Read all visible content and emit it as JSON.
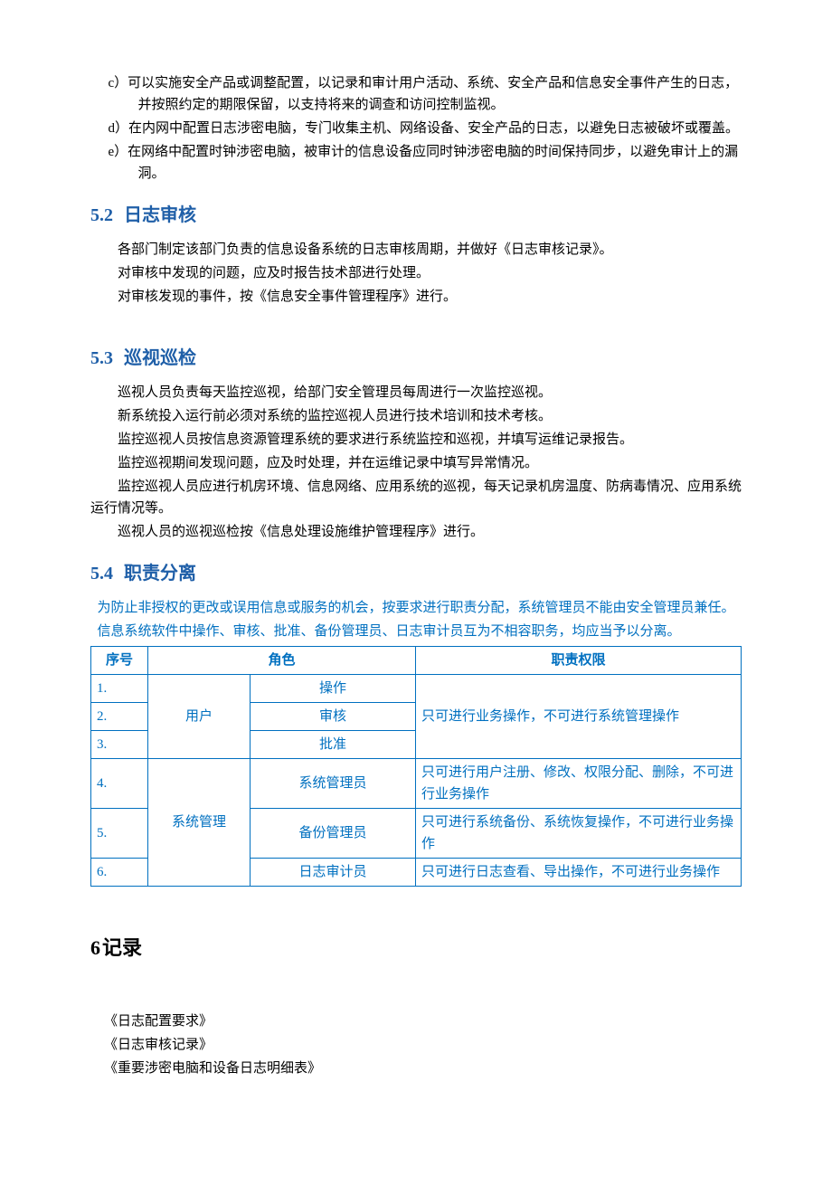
{
  "intro_items": [
    "c）可以实施安全产品或调整配置，以记录和审计用户活动、系统、安全产品和信息安全事件产生的日志，并按照约定的期限保留，以支持将来的调查和访问控制监视。",
    "d）在内网中配置日志涉密电脑，专门收集主机、网络设备、安全产品的日志，以避免日志被破坏或覆盖。",
    "e）在网络中配置时钟涉密电脑，被审计的信息设备应同时钟涉密电脑的时间保持同步，以避免审计上的漏洞。"
  ],
  "s52": {
    "num": "5.2",
    "title": "日志审核",
    "paras": [
      "各部门制定该部门负责的信息设备系统的日志审核周期，并做好《日志审核记录》。",
      "对审核中发现的问题，应及时报告技术部进行处理。",
      "对审核发现的事件，按《信息安全事件管理程序》进行。"
    ]
  },
  "s53": {
    "num": "5.3",
    "title": "巡视巡检",
    "paras": [
      "巡视人员负责每天监控巡视，给部门安全管理员每周进行一次监控巡视。",
      "新系统投入运行前必须对系统的监控巡视人员进行技术培训和技术考核。",
      "监控巡视人员按信息资源管理系统的要求进行系统监控和巡视，并填写运维记录报告。",
      "监控巡视期间发现问题，应及时处理，并在运维记录中填写异常情况。",
      "监控巡视人员应进行机房环境、信息网络、应用系统的巡视，每天记录机房温度、防病毒情况、应用系统运行情况等。",
      "巡视人员的巡视巡检按《信息处理设施维护管理程序》进行。"
    ]
  },
  "s54": {
    "num": "5.4",
    "title": "职责分离",
    "intro1": "为防止非授权的更改或误用信息或服务的机会，按要求进行职责分配，系统管理员不能由安全管理员兼任。",
    "intro2": "信息系统软件中操作、审核、批准、备份管理员、日志审计员互为不相容职务，均应当予以分离。",
    "headers": {
      "c1": "序号",
      "c2": "角色",
      "c3": "职责权限"
    },
    "groups": [
      {
        "group_label": "用户",
        "permission": "只可进行业务操作，不可进行系统管理操作",
        "rows": [
          {
            "n": "1.",
            "role": "操作"
          },
          {
            "n": "2.",
            "role": "审核"
          },
          {
            "n": "3.",
            "role": "批准"
          }
        ]
      },
      {
        "group_label": "系统管理",
        "rows": [
          {
            "n": "4.",
            "role": "系统管理员",
            "permission": "只可进行用户注册、修改、权限分配、删除，不可进行业务操作"
          },
          {
            "n": "5.",
            "role": "备份管理员",
            "permission": "只可进行系统备份、系统恢复操作，不可进行业务操作"
          },
          {
            "n": "6.",
            "role": "日志审计员",
            "permission": "只可进行日志查看、导出操作，不可进行业务操作"
          }
        ]
      }
    ]
  },
  "s6": {
    "num": "6",
    "title": "记录",
    "items": [
      "《日志配置要求》",
      "《日志审核记录》",
      "《重要涉密电脑和设备日志明细表》"
    ]
  }
}
